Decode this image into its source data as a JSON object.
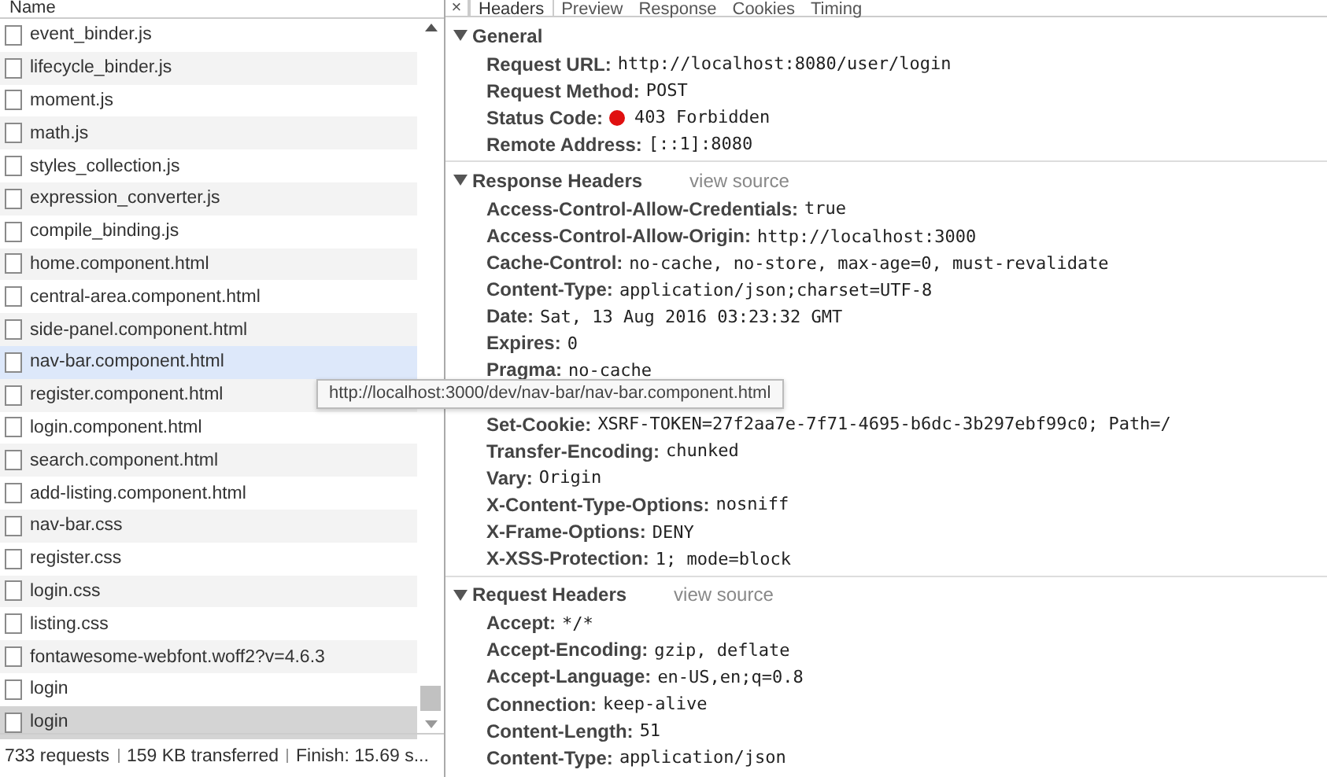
{
  "requests": {
    "column_header": "Name",
    "rows": [
      {
        "name": "event_binder.js",
        "selected": false,
        "hovered": false
      },
      {
        "name": "lifecycle_binder.js",
        "selected": false,
        "hovered": false
      },
      {
        "name": "moment.js",
        "selected": false,
        "hovered": false
      },
      {
        "name": "math.js",
        "selected": false,
        "hovered": false
      },
      {
        "name": "styles_collection.js",
        "selected": false,
        "hovered": false
      },
      {
        "name": "expression_converter.js",
        "selected": false,
        "hovered": false
      },
      {
        "name": "compile_binding.js",
        "selected": false,
        "hovered": false
      },
      {
        "name": "home.component.html",
        "selected": false,
        "hovered": false
      },
      {
        "name": "central-area.component.html",
        "selected": false,
        "hovered": false
      },
      {
        "name": "side-panel.component.html",
        "selected": false,
        "hovered": false
      },
      {
        "name": "nav-bar.component.html",
        "selected": false,
        "hovered": true
      },
      {
        "name": "register.component.html",
        "selected": false,
        "hovered": false
      },
      {
        "name": "login.component.html",
        "selected": false,
        "hovered": false
      },
      {
        "name": "search.component.html",
        "selected": false,
        "hovered": false
      },
      {
        "name": "add-listing.component.html",
        "selected": false,
        "hovered": false
      },
      {
        "name": "nav-bar.css",
        "selected": false,
        "hovered": false
      },
      {
        "name": "register.css",
        "selected": false,
        "hovered": false
      },
      {
        "name": "login.css",
        "selected": false,
        "hovered": false
      },
      {
        "name": "listing.css",
        "selected": false,
        "hovered": false
      },
      {
        "name": "fontawesome-webfont.woff2?v=4.6.3",
        "selected": false,
        "hovered": false
      },
      {
        "name": "login",
        "selected": false,
        "hovered": false
      },
      {
        "name": "login",
        "selected": true,
        "hovered": false
      }
    ],
    "status_bar": [
      "733 requests",
      "159 KB transferred",
      "Finish: 15.69 s..."
    ]
  },
  "detail": {
    "close": "×",
    "tabs": [
      {
        "label": "Headers",
        "selected": true
      },
      {
        "label": "Preview",
        "selected": false
      },
      {
        "label": "Response",
        "selected": false
      },
      {
        "label": "Cookies",
        "selected": false
      },
      {
        "label": "Timing",
        "selected": false
      }
    ],
    "sections": [
      {
        "title": "General",
        "expanded": true,
        "rows": [
          {
            "key": "Request URL:",
            "value": "http://localhost:8080/user/login"
          },
          {
            "key": "Request Method:",
            "value": "POST"
          },
          {
            "key": "Status Code:",
            "value": "403 Forbidden",
            "color": "#e01010"
          },
          {
            "key": "Remote Address:",
            "value": "[::1]:8080"
          }
        ]
      },
      {
        "title": "Response Headers",
        "link": "view source",
        "expanded": true,
        "rows": [
          {
            "key": "Access-Control-Allow-Credentials:",
            "value": "true"
          },
          {
            "key": "Access-Control-Allow-Origin:",
            "value": "http://localhost:3000"
          },
          {
            "key": "Cache-Control:",
            "value": "no-cache, no-store, max-age=0, must-revalidate"
          },
          {
            "key": "Content-Type:",
            "value": "application/json;charset=UTF-8"
          },
          {
            "key": "Date:",
            "value": "Sat, 13 Aug 2016 03:23:32 GMT"
          },
          {
            "key": "Expires:",
            "value": "0"
          },
          {
            "key": "Pragma:",
            "value": "no-cache"
          },
          {
            "kind": "tooltip",
            "text": "http://localhost:3000/dev/nav-bar/nav-bar.component.html"
          },
          {
            "key": "Set-Cookie:",
            "value": "XSRF-TOKEN=27f2aa7e-7f71-4695-b6dc-3b297ebf99c0; Path=/"
          },
          {
            "key": "Transfer-Encoding:",
            "value": "chunked"
          },
          {
            "key": "Vary:",
            "value": "Origin"
          },
          {
            "key": "X-Content-Type-Options:",
            "value": "nosniff"
          },
          {
            "key": "X-Frame-Options:",
            "value": "DENY"
          },
          {
            "key": "X-XSS-Protection:",
            "value": "1; mode=block"
          }
        ]
      },
      {
        "title": "Request Headers",
        "link": "view source",
        "expanded": true,
        "rows": [
          {
            "key": "Accept:",
            "value": "*/*"
          },
          {
            "key": "Accept-Encoding:",
            "value": "gzip, deflate"
          },
          {
            "key": "Accept-Language:",
            "value": "en-US,en;q=0.8"
          },
          {
            "key": "Connection:",
            "value": "keep-alive"
          },
          {
            "key": "Content-Length:",
            "value": "51"
          },
          {
            "key": "Content-Type:",
            "value": "application/json"
          }
        ]
      }
    ]
  }
}
